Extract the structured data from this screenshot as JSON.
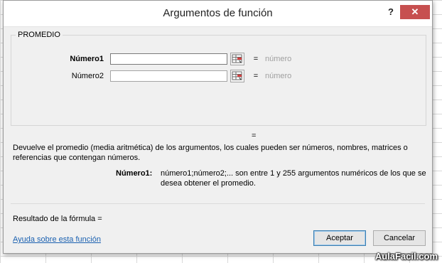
{
  "dialog": {
    "title": "Argumentos de función",
    "help_label": "?",
    "close_label": "✕",
    "function_name": "PROMEDIO",
    "arguments": [
      {
        "label": "Número1",
        "value": "",
        "equals": "=",
        "preview": "número",
        "bold": true
      },
      {
        "label": "Número2",
        "value": "",
        "equals": "=",
        "preview": "número",
        "bold": false
      }
    ],
    "result_equals": "=",
    "description": "Devuelve el promedio (media aritmética) de los argumentos, los cuales pueden ser números, nombres, matrices o referencias que contengan números.",
    "arg_help_label": "Número1:",
    "arg_help_text": "número1;número2;... son entre 1 y 255 argumentos numéricos de los que se desea obtener el promedio.",
    "formula_result_label": "Resultado de la fórmula =",
    "help_link": "Ayuda sobre esta función",
    "ok_label": "Aceptar",
    "cancel_label": "Cancelar"
  },
  "watermark": "AulaFacil.com",
  "colors": {
    "close_button": "#c75050",
    "link": "#1a60b0",
    "dialog_bg": "#f0f0f0"
  },
  "icons": [
    "range-selector-icon",
    "help-icon",
    "close-icon"
  ]
}
